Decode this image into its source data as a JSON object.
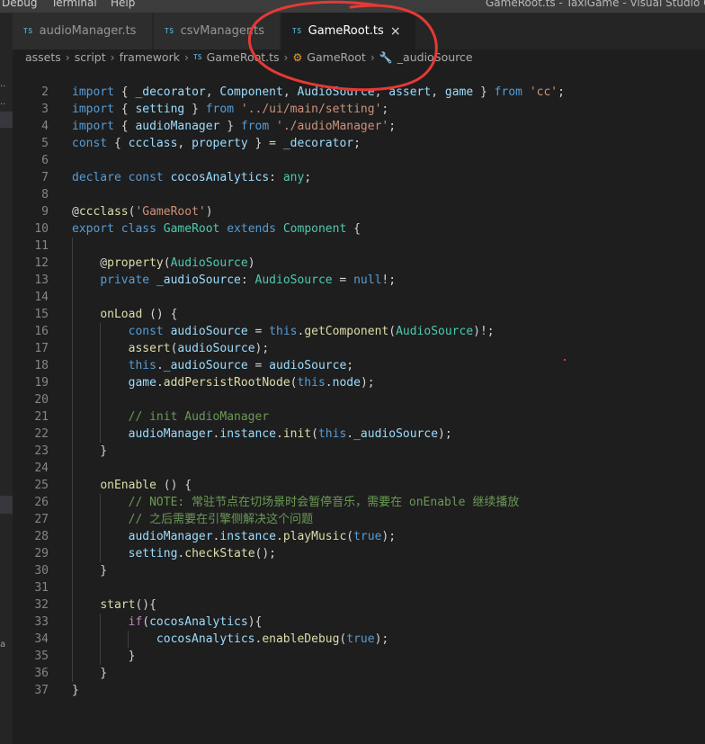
{
  "titlebar": {
    "menu": [
      "Debug",
      "Terminal",
      "Help"
    ],
    "window_title": "GameRoot.ts - TaxiGame - Visual Studio Code"
  },
  "activity": {
    "marks": [
      "..",
      "..",
      "a"
    ]
  },
  "tabs": [
    {
      "icon": "TS",
      "label": "audioManager.ts",
      "active": false
    },
    {
      "icon": "TS",
      "label": "csvManager.ts",
      "active": false
    },
    {
      "icon": "TS",
      "label": "GameRoot.ts",
      "active": true,
      "close": "×"
    }
  ],
  "breadcrumb": [
    "assets",
    "script",
    "framework",
    "GameRoot.ts",
    "GameRoot",
    "_audioSource"
  ],
  "code_lines": [
    {
      "n": "2",
      "indent": 0,
      "tokens": [
        [
          "k",
          "import"
        ],
        [
          "p",
          " { "
        ],
        [
          "v",
          "_decorator"
        ],
        [
          "p",
          ", "
        ],
        [
          "v",
          "Component"
        ],
        [
          "p",
          ", "
        ],
        [
          "v",
          "AudioSource"
        ],
        [
          "p",
          ", "
        ],
        [
          "v",
          "assert"
        ],
        [
          "p",
          ", "
        ],
        [
          "v",
          "game"
        ],
        [
          "p",
          " } "
        ],
        [
          "k",
          "from"
        ],
        [
          "p",
          " "
        ],
        [
          "s",
          "'cc'"
        ],
        [
          "p",
          ";"
        ]
      ]
    },
    {
      "n": "3",
      "indent": 0,
      "tokens": [
        [
          "k",
          "import"
        ],
        [
          "p",
          " { "
        ],
        [
          "v",
          "setting"
        ],
        [
          "p",
          " } "
        ],
        [
          "k",
          "from"
        ],
        [
          "p",
          " "
        ],
        [
          "s",
          "'../ui/main/setting'"
        ],
        [
          "p",
          ";"
        ]
      ]
    },
    {
      "n": "4",
      "indent": 0,
      "tokens": [
        [
          "k",
          "import"
        ],
        [
          "p",
          " { "
        ],
        [
          "v",
          "audioManager"
        ],
        [
          "p",
          " } "
        ],
        [
          "k",
          "from"
        ],
        [
          "p",
          " "
        ],
        [
          "s",
          "'./audioManager'"
        ],
        [
          "p",
          ";"
        ]
      ]
    },
    {
      "n": "5",
      "indent": 0,
      "tokens": [
        [
          "k",
          "const"
        ],
        [
          "p",
          " { "
        ],
        [
          "v",
          "ccclass"
        ],
        [
          "p",
          ", "
        ],
        [
          "v",
          "property"
        ],
        [
          "p",
          " } = "
        ],
        [
          "v",
          "_decorator"
        ],
        [
          "p",
          ";"
        ]
      ]
    },
    {
      "n": "6",
      "indent": 0,
      "tokens": []
    },
    {
      "n": "7",
      "indent": 0,
      "tokens": [
        [
          "k",
          "declare"
        ],
        [
          "p",
          " "
        ],
        [
          "k",
          "const"
        ],
        [
          "p",
          " "
        ],
        [
          "v",
          "cocosAnalytics"
        ],
        [
          "p",
          ": "
        ],
        [
          "t",
          "any"
        ],
        [
          "p",
          ";"
        ]
      ]
    },
    {
      "n": "8",
      "indent": 0,
      "tokens": []
    },
    {
      "n": "9",
      "indent": 0,
      "tokens": [
        [
          "p",
          "@"
        ],
        [
          "f",
          "ccclass"
        ],
        [
          "p",
          "("
        ],
        [
          "s",
          "'GameRoot'"
        ],
        [
          "p",
          ")"
        ]
      ]
    },
    {
      "n": "10",
      "indent": 0,
      "tokens": [
        [
          "k",
          "export"
        ],
        [
          "p",
          " "
        ],
        [
          "k",
          "class"
        ],
        [
          "p",
          " "
        ],
        [
          "t",
          "GameRoot"
        ],
        [
          "p",
          " "
        ],
        [
          "k",
          "extends"
        ],
        [
          "p",
          " "
        ],
        [
          "t",
          "Component"
        ],
        [
          "p",
          " {"
        ]
      ]
    },
    {
      "n": "11",
      "indent": 1,
      "tokens": []
    },
    {
      "n": "12",
      "indent": 1,
      "tokens": [
        [
          "p",
          "    @"
        ],
        [
          "f",
          "property"
        ],
        [
          "p",
          "("
        ],
        [
          "t",
          "AudioSource"
        ],
        [
          "p",
          ")"
        ]
      ]
    },
    {
      "n": "13",
      "indent": 1,
      "tokens": [
        [
          "p",
          "    "
        ],
        [
          "k",
          "private"
        ],
        [
          "p",
          " "
        ],
        [
          "v",
          "_audioSource"
        ],
        [
          "p",
          ": "
        ],
        [
          "t",
          "AudioSource"
        ],
        [
          "p",
          " = "
        ],
        [
          "k",
          "null"
        ],
        [
          "p",
          "!;"
        ]
      ]
    },
    {
      "n": "14",
      "indent": 1,
      "tokens": []
    },
    {
      "n": "15",
      "indent": 1,
      "tokens": [
        [
          "p",
          "    "
        ],
        [
          "f",
          "onLoad"
        ],
        [
          "p",
          " () {"
        ]
      ]
    },
    {
      "n": "16",
      "indent": 2,
      "tokens": [
        [
          "p",
          "        "
        ],
        [
          "k",
          "const"
        ],
        [
          "p",
          " "
        ],
        [
          "v",
          "audioSource"
        ],
        [
          "p",
          " = "
        ],
        [
          "k",
          "this"
        ],
        [
          "p",
          "."
        ],
        [
          "f",
          "getComponent"
        ],
        [
          "p",
          "("
        ],
        [
          "t",
          "AudioSource"
        ],
        [
          "p",
          ")!;"
        ]
      ]
    },
    {
      "n": "17",
      "indent": 2,
      "tokens": [
        [
          "p",
          "        "
        ],
        [
          "f",
          "assert"
        ],
        [
          "p",
          "("
        ],
        [
          "v",
          "audioSource"
        ],
        [
          "p",
          ");"
        ]
      ]
    },
    {
      "n": "18",
      "indent": 2,
      "tokens": [
        [
          "p",
          "        "
        ],
        [
          "k",
          "this"
        ],
        [
          "p",
          "."
        ],
        [
          "v",
          "_audioSource"
        ],
        [
          "p",
          " = "
        ],
        [
          "v",
          "audioSource"
        ],
        [
          "p",
          ";"
        ]
      ]
    },
    {
      "n": "19",
      "indent": 2,
      "tokens": [
        [
          "p",
          "        "
        ],
        [
          "v",
          "game"
        ],
        [
          "p",
          "."
        ],
        [
          "f",
          "addPersistRootNode"
        ],
        [
          "p",
          "("
        ],
        [
          "k",
          "this"
        ],
        [
          "p",
          "."
        ],
        [
          "v",
          "node"
        ],
        [
          "p",
          ");"
        ]
      ]
    },
    {
      "n": "20",
      "indent": 2,
      "tokens": []
    },
    {
      "n": "21",
      "indent": 2,
      "tokens": [
        [
          "p",
          "        "
        ],
        [
          "cm",
          "// init AudioManager"
        ]
      ]
    },
    {
      "n": "22",
      "indent": 2,
      "tokens": [
        [
          "p",
          "        "
        ],
        [
          "v",
          "audioManager"
        ],
        [
          "p",
          "."
        ],
        [
          "v",
          "instance"
        ],
        [
          "p",
          "."
        ],
        [
          "f",
          "init"
        ],
        [
          "p",
          "("
        ],
        [
          "k",
          "this"
        ],
        [
          "p",
          "."
        ],
        [
          "v",
          "_audioSource"
        ],
        [
          "p",
          ");"
        ]
      ]
    },
    {
      "n": "23",
      "indent": 1,
      "tokens": [
        [
          "p",
          "    }"
        ]
      ]
    },
    {
      "n": "24",
      "indent": 1,
      "tokens": []
    },
    {
      "n": "25",
      "indent": 1,
      "tokens": [
        [
          "p",
          "    "
        ],
        [
          "f",
          "onEnable"
        ],
        [
          "p",
          " () {"
        ]
      ]
    },
    {
      "n": "26",
      "indent": 2,
      "tokens": [
        [
          "p",
          "        "
        ],
        [
          "cm",
          "// NOTE: 常驻节点在切场景时会暂停音乐，需要在 onEnable 继续播放"
        ]
      ]
    },
    {
      "n": "27",
      "indent": 2,
      "tokens": [
        [
          "p",
          "        "
        ],
        [
          "cm",
          "// 之后需要在引擎侧解决这个问题"
        ]
      ]
    },
    {
      "n": "28",
      "indent": 2,
      "tokens": [
        [
          "p",
          "        "
        ],
        [
          "v",
          "audioManager"
        ],
        [
          "p",
          "."
        ],
        [
          "v",
          "instance"
        ],
        [
          "p",
          "."
        ],
        [
          "f",
          "playMusic"
        ],
        [
          "p",
          "("
        ],
        [
          "k",
          "true"
        ],
        [
          "p",
          ");"
        ]
      ]
    },
    {
      "n": "29",
      "indent": 2,
      "tokens": [
        [
          "p",
          "        "
        ],
        [
          "v",
          "setting"
        ],
        [
          "p",
          "."
        ],
        [
          "f",
          "checkState"
        ],
        [
          "p",
          "();"
        ]
      ]
    },
    {
      "n": "30",
      "indent": 1,
      "tokens": [
        [
          "p",
          "    }"
        ]
      ]
    },
    {
      "n": "31",
      "indent": 1,
      "tokens": []
    },
    {
      "n": "32",
      "indent": 1,
      "tokens": [
        [
          "p",
          "    "
        ],
        [
          "f",
          "start"
        ],
        [
          "p",
          "(){"
        ]
      ]
    },
    {
      "n": "33",
      "indent": 2,
      "tokens": [
        [
          "p",
          "        "
        ],
        [
          "c",
          "if"
        ],
        [
          "p",
          "("
        ],
        [
          "v",
          "cocosAnalytics"
        ],
        [
          "p",
          "){"
        ]
      ]
    },
    {
      "n": "34",
      "indent": 3,
      "tokens": [
        [
          "p",
          "            "
        ],
        [
          "v",
          "cocosAnalytics"
        ],
        [
          "p",
          "."
        ],
        [
          "f",
          "enableDebug"
        ],
        [
          "p",
          "("
        ],
        [
          "k",
          "true"
        ],
        [
          "p",
          ");"
        ]
      ]
    },
    {
      "n": "35",
      "indent": 2,
      "tokens": [
        [
          "p",
          "        }"
        ]
      ]
    },
    {
      "n": "36",
      "indent": 1,
      "tokens": [
        [
          "p",
          "    }"
        ]
      ]
    },
    {
      "n": "37",
      "indent": 0,
      "tokens": [
        [
          "p",
          "}"
        ]
      ]
    }
  ],
  "colors": {
    "annotation": "#e53935",
    "keyword": "#569cd6",
    "string": "#ce9178",
    "type": "#4ec9b0",
    "comment": "#6a9955"
  }
}
